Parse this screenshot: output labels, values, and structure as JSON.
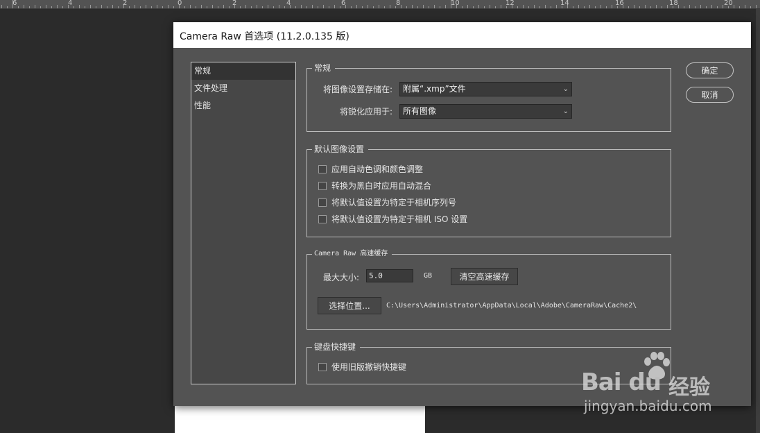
{
  "ruler": {
    "labels": [
      "6",
      "4",
      "2",
      "0",
      "2",
      "4",
      "6",
      "8",
      "10",
      "12",
      "14",
      "16",
      "18",
      "20"
    ]
  },
  "dialog": {
    "title": "Camera Raw 首选项  (11.2.0.135 版)",
    "nav_items": [
      "常规",
      "文件处理",
      "性能"
    ],
    "buttons": {
      "ok": "确定",
      "cancel": "取消"
    },
    "general": {
      "legend": "常规",
      "save_label": "将图像设置存储在:",
      "save_value": "附属“.xmp”文件",
      "sharpen_label": "将锐化应用于:",
      "sharpen_value": "所有图像"
    },
    "defaults": {
      "legend": "默认图像设置",
      "options": [
        "应用自动色调和颜色调整",
        "转换为黑白时应用自动混合",
        "将默认值设置为特定于相机序列号",
        "将默认值设置为特定于相机 ISO 设置"
      ]
    },
    "cache": {
      "legend": "Camera Raw 高速缓存",
      "max_label": "最大大小:",
      "max_value": "5.0",
      "unit": "GB",
      "purge_label": "清空高速缓存",
      "choose_label": "选择位置...",
      "path": "C:\\Users\\Administrator\\AppData\\Local\\Adobe\\CameraRaw\\Cache2\\"
    },
    "keyboard": {
      "legend": "键盘快捷键",
      "option": "使用旧版撤销快捷键"
    }
  },
  "watermark": {
    "logo_text": "Bai du",
    "cn_text": "经验",
    "url": "jingyan.baidu.com"
  },
  "colors": {
    "dialog_bg": "#535353",
    "titlebar_bg": "#ffffff",
    "nav_selected": "#333333"
  }
}
